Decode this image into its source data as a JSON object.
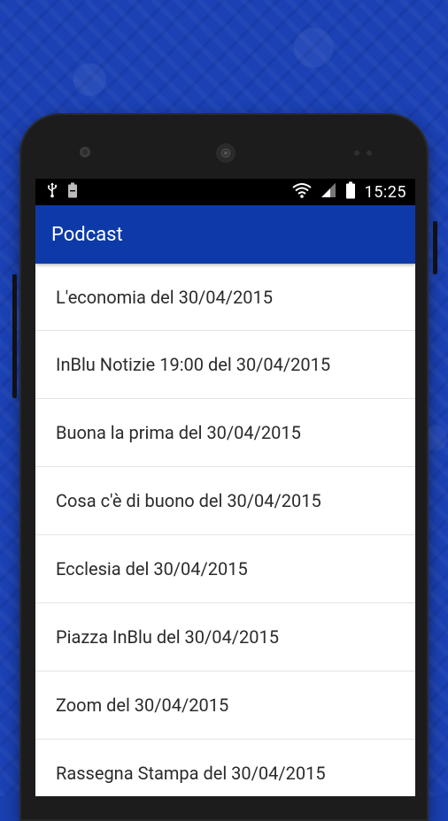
{
  "status_bar": {
    "time": "15:25",
    "icons": [
      "usb-icon",
      "battery-saver-icon",
      "wifi-icon",
      "signal-icon",
      "battery-icon"
    ]
  },
  "app_bar": {
    "title": "Podcast",
    "color": "#0d3aa8"
  },
  "podcasts": [
    {
      "title": "L'economia del 30/04/2015"
    },
    {
      "title": "InBlu Notizie 19:00 del 30/04/2015"
    },
    {
      "title": "Buona la prima del 30/04/2015"
    },
    {
      "title": "Cosa c'è di buono del 30/04/2015"
    },
    {
      "title": "Ecclesia del 30/04/2015"
    },
    {
      "title": "Piazza InBlu del 30/04/2015"
    },
    {
      "title": "Zoom del 30/04/2015"
    },
    {
      "title": "Rassegna Stampa del 30/04/2015"
    }
  ]
}
